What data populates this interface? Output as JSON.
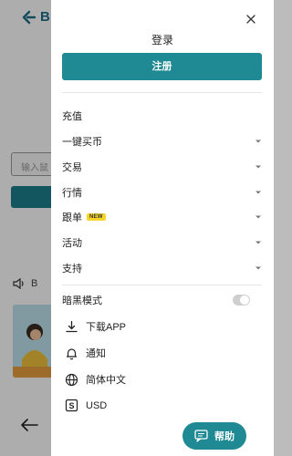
{
  "background": {
    "logo_text": "B",
    "input_placeholder": "输入鼠",
    "speaker_text": "B"
  },
  "drawer": {
    "login_label": "登录",
    "register_label": "注册",
    "menu": [
      {
        "label": "充值",
        "has_chevron": false
      },
      {
        "label": "一键买币",
        "has_chevron": true
      },
      {
        "label": "交易",
        "has_chevron": true
      },
      {
        "label": "行情",
        "has_chevron": true
      },
      {
        "label": "跟单",
        "badge": "NEW",
        "has_chevron": true
      },
      {
        "label": "活动",
        "has_chevron": true
      },
      {
        "label": "支持",
        "has_chevron": true
      }
    ],
    "dark_mode": {
      "label": "暗黑模式",
      "enabled": false
    },
    "settings": [
      {
        "icon": "download-icon",
        "label": "下载APP"
      },
      {
        "icon": "bell-icon",
        "label": "通知"
      },
      {
        "icon": "globe-icon",
        "label": "简体中文"
      },
      {
        "icon": "currency-icon",
        "label": "USD"
      }
    ],
    "help_label": "帮助"
  },
  "colors": {
    "accent": "#1f8a93",
    "badge": "#f5d42c",
    "toggle_off": "#cfcfcf"
  }
}
